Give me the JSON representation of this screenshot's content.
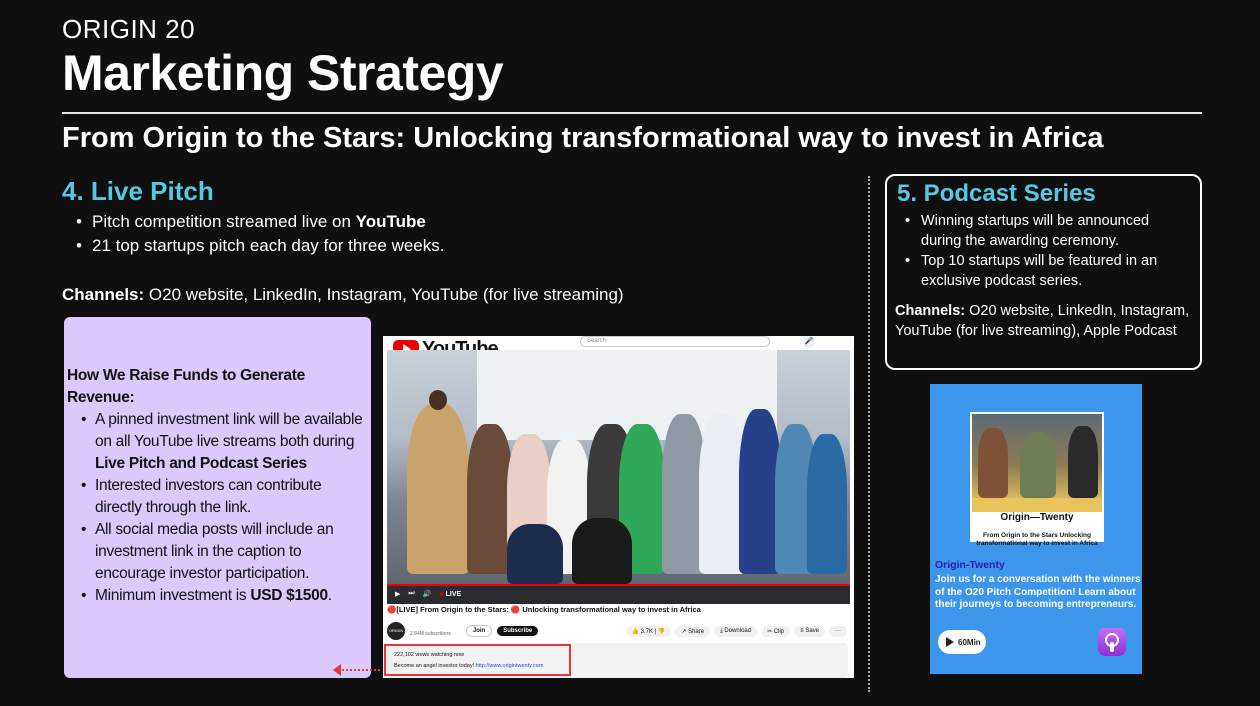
{
  "header": {
    "label": "ORIGIN 20",
    "title": "Marketing Strategy",
    "subtitle": "From Origin to the Stars: Unlocking transformational way to invest in Africa"
  },
  "live_pitch": {
    "title": "4. Live Pitch",
    "bullet1_pre": "Pitch competition streamed live on ",
    "bullet1_bold": "YouTube",
    "bullet2": "21 top startups pitch each day for three weeks.",
    "channels_label": "Channels:",
    "channels_text": " O20 website, LinkedIn, Instagram, YouTube (for live streaming)"
  },
  "podcast": {
    "title": "5. Podcast Series",
    "bullets": [
      "Winning startups will be announced during the awarding ceremony.",
      "Top 10 startups will be featured in an exclusive podcast series."
    ],
    "channels_label": "Channels:",
    "channels_text": " O20 website, LinkedIn, Instagram, YouTube (for live streaming), Apple Podcast"
  },
  "funds": {
    "heading": "How We Raise Funds to Generate Revenue:",
    "b1_pre": "A pinned investment link will be available  on all YouTube live streams both during ",
    "b1_bold": "Live Pitch and Podcast Series",
    "b2": "Interested investors can contribute directly through the link.",
    "b3": "All social media posts will include an investment link in the caption to encourage investor participation.",
    "b4_pre": "Minimum investment is ",
    "b4_bold": "USD $1500",
    "b4_post": "."
  },
  "youtube": {
    "logo_text": "YouTube",
    "search_placeholder": "Search",
    "live_label": "LIVE",
    "video_title": "🔴[LIVE] From Origin to the Stars: 🔴 Unlocking transformational way to invest in Africa",
    "channel_avatar_text": "ORIGIN 20",
    "subscribers": "2.84M subscribers",
    "join": "Join",
    "subscribe": "Subscribe",
    "likes": "3.7K",
    "share": "Share",
    "download": "Download",
    "clip": "Clip",
    "save": "Save",
    "more": "···",
    "watching": "222,102 views  watching now",
    "cta_text": "Become an angel investor today! ",
    "cta_link": "http://www.origintwenty.com"
  },
  "podcast_card": {
    "cover_brand": "Origin—Twenty",
    "cover_text": "From Origin to the Stars Unlocking transformational way to invest in Africa",
    "name": "Origin-Twenty",
    "description": "Join us for a conversation with the winners of the O20 Pitch Competition! Learn about their journeys to becoming entrepreneurs.",
    "duration": "60Min"
  },
  "colors": {
    "accent_cyan": "#56c8e4",
    "funds_bg": "#dcc9fb",
    "podcast_card_bg": "#3b96ec",
    "highlight_red": "#e0393e"
  }
}
